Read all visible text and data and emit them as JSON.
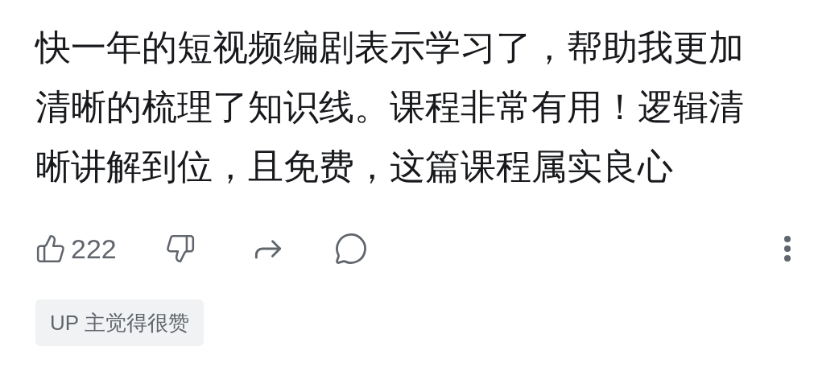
{
  "comment": {
    "text": "快一年的短视频编剧表示学习了，帮助我更加清晰的梳理了知识线。课程非常有用！逻辑清晰讲解到位，且免费，这篇课程属实良心"
  },
  "actions": {
    "like_count": "222"
  },
  "badge": "UP 主觉得很赞"
}
